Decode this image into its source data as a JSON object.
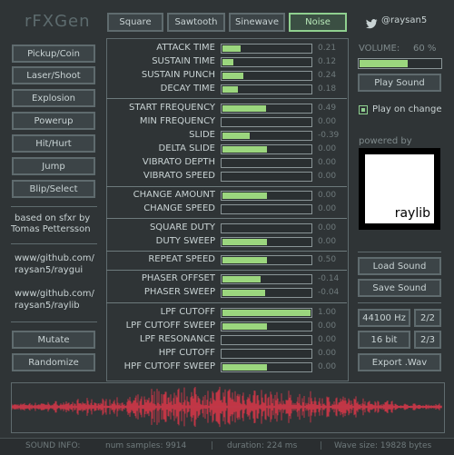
{
  "app": {
    "title": "rFXGen"
  },
  "tabs": [
    {
      "label": "Square",
      "active": false
    },
    {
      "label": "Sawtooth",
      "active": false
    },
    {
      "label": "Sinewave",
      "active": false
    },
    {
      "label": "Noise",
      "active": true
    }
  ],
  "twitter": {
    "handle": "@raysan5",
    "icon": "twitter-icon"
  },
  "left_buttons": [
    "Pickup/Coin",
    "Laser/Shoot",
    "Explosion",
    "Powerup",
    "Hit/Hurt",
    "Jump",
    "Blip/Select"
  ],
  "credits": {
    "line1": "based on sfxr by",
    "line2": "Tomas Pettersson",
    "link1a": "www/github.com/",
    "link1b": "raysan5/raygui",
    "link2a": "www/github.com/",
    "link2b": "raysan5/raylib"
  },
  "bottom_buttons": {
    "mutate": "Mutate",
    "randomize": "Randomize"
  },
  "params": [
    {
      "label": "ATTACK TIME",
      "value": "0.21",
      "fill": 0.21
    },
    {
      "label": "SUSTAIN TIME",
      "value": "0.12",
      "fill": 0.12
    },
    {
      "label": "SUSTAIN PUNCH",
      "value": "0.24",
      "fill": 0.24
    },
    {
      "label": "DECAY TIME",
      "value": "0.18",
      "fill": 0.18
    },
    {
      "label": "START FREQUENCY",
      "value": "0.49",
      "fill": 0.49
    },
    {
      "label": "MIN FREQUENCY",
      "value": "0.00",
      "fill": 0
    },
    {
      "label": "SLIDE",
      "value": "-0.39",
      "fill": 0.305
    },
    {
      "label": "DELTA SLIDE",
      "value": "0.00",
      "fill": 0.5
    },
    {
      "label": "VIBRATO DEPTH",
      "value": "0.00",
      "fill": 0
    },
    {
      "label": "VIBRATO SPEED",
      "value": "0.00",
      "fill": 0
    },
    {
      "label": "CHANGE AMOUNT",
      "value": "0.00",
      "fill": 0.5
    },
    {
      "label": "CHANGE SPEED",
      "value": "0.00",
      "fill": 0
    },
    {
      "label": "SQUARE DUTY",
      "value": "0.00",
      "fill": 0
    },
    {
      "label": "DUTY SWEEP",
      "value": "0.00",
      "fill": 0.5
    },
    {
      "label": "REPEAT SPEED",
      "value": "0.50",
      "fill": 0.5
    },
    {
      "label": "PHASER OFFSET",
      "value": "-0.14",
      "fill": 0.43
    },
    {
      "label": "PHASER SWEEP",
      "value": "-0.04",
      "fill": 0.48
    },
    {
      "label": "LPF CUTOFF",
      "value": "1.00",
      "fill": 1.0
    },
    {
      "label": "LPF CUTOFF SWEEP",
      "value": "0.00",
      "fill": 0.5
    },
    {
      "label": "LPF RESONANCE",
      "value": "0.00",
      "fill": 0
    },
    {
      "label": "HPF CUTOFF",
      "value": "0.00",
      "fill": 0
    },
    {
      "label": "HPF CUTOFF SWEEP",
      "value": "0.00",
      "fill": 0.5
    }
  ],
  "volume": {
    "label": "VOLUME:",
    "value": "60 %",
    "fill": 0.6
  },
  "play_sound": "Play Sound",
  "play_on_change": {
    "label": "Play on change",
    "checked": true
  },
  "powered_by": "powered by",
  "logo_text": "raylib",
  "load_sound": "Load Sound",
  "save_sound": "Save Sound",
  "sample_rate": {
    "value": "44100 Hz",
    "page": "2/2"
  },
  "bit_depth": {
    "value": "16 bit",
    "page": "2/3"
  },
  "export": "Export .Wav",
  "status": {
    "label": "SOUND INFO:",
    "samples": "num samples: 9914",
    "duration": "duration: 224 ms",
    "size": "Wave size: 19828 bytes"
  },
  "colors": {
    "accent": "#9bd67e",
    "wave": "#e6374a",
    "border": "#5f6b6e"
  }
}
